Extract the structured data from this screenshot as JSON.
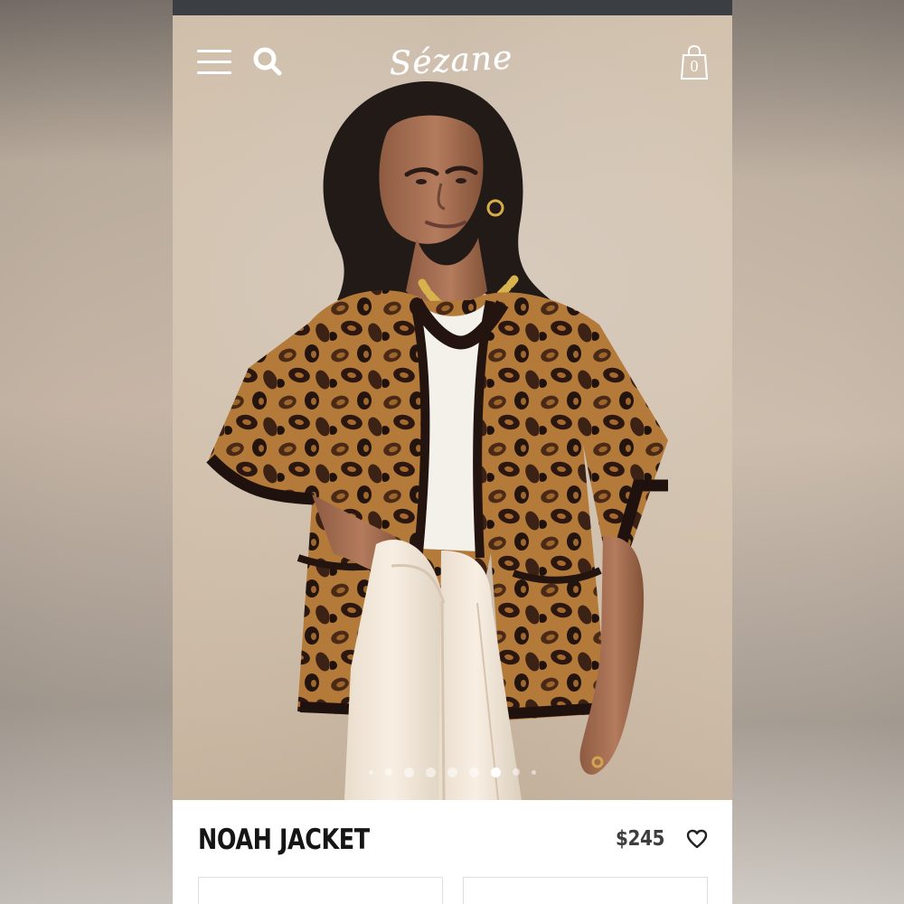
{
  "brand": {
    "name": "Sézane"
  },
  "header": {
    "cart_count": "0",
    "icons": [
      "menu-icon",
      "search-icon",
      "shopping-bag-icon"
    ]
  },
  "product": {
    "title": "NOAH JACKET",
    "price": "$245"
  },
  "carousel": {
    "dot_count": 9,
    "active_dot_index": 6
  },
  "colors": {
    "status_bar": "#3b3e42",
    "text_primary": "#151515",
    "price_text": "#3e3e3e",
    "background_beige": "#d7c8b8",
    "leopard_tan": "#b47a39",
    "leopard_dark": "#2b1710",
    "white": "#ffffff"
  }
}
